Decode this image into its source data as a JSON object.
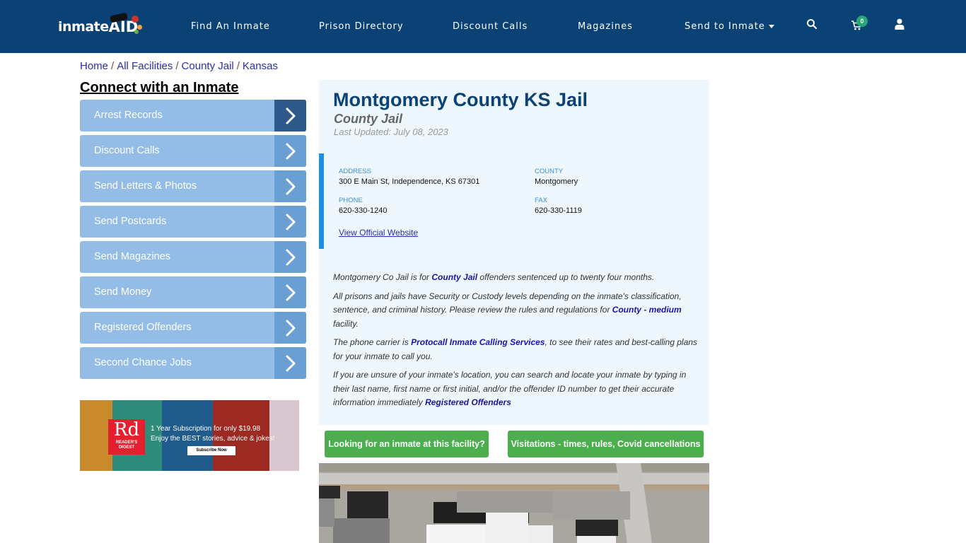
{
  "header": {
    "logo_text": "inmate",
    "logo_aid": "AID",
    "nav": [
      {
        "label": "Find An Inmate"
      },
      {
        "label": "Prison Directory"
      },
      {
        "label": "Discount Calls"
      },
      {
        "label": "Magazines"
      },
      {
        "label": "Send to Inmate",
        "has_dropdown": true
      }
    ],
    "icons": [
      "search-icon",
      "cart-icon",
      "user-icon"
    ],
    "cart_count": "0",
    "colors": {
      "bar": "#0b4275",
      "badge": "#25a776"
    }
  },
  "breadcrumb": {
    "items": [
      "Home",
      "All Facilities",
      "County Jail",
      "Kansas"
    ],
    "separator": "/"
  },
  "sidebar": {
    "title": "Connect with an Inmate",
    "items": [
      {
        "label": "Arrest Records"
      },
      {
        "label": "Discount Calls"
      },
      {
        "label": "Send Letters & Photos"
      },
      {
        "label": "Send Postcards"
      },
      {
        "label": "Send Magazines"
      },
      {
        "label": "Send Money"
      },
      {
        "label": "Registered Offenders"
      },
      {
        "label": "Second Chance Jobs"
      }
    ],
    "ad": {
      "brand_big": "Rd",
      "brand_small_1": "READER'S",
      "brand_small_2": "DIGEST",
      "line1": "1 Year Subscription for only $19.98",
      "line2": "Enjoy the BEST stories, advice & jokes!",
      "button": "Subscribe Now"
    }
  },
  "facility": {
    "name": "Montgomery County KS Jail",
    "type": "County Jail",
    "last_updated": "Last Updated: July 08, 2023",
    "address_label": "ADDRESS",
    "address": "300 E Main St, Independence, KS 67301",
    "county_label": "COUNTY",
    "county": "Montgomery",
    "phone_label": "PHONE",
    "phone": "620-330-1240",
    "fax_label": "FAX",
    "fax": "620-330-1119",
    "website_link": "View Official Website"
  },
  "description": {
    "p1_pre": "Montgomery Co Jail is for ",
    "p1_link": "County Jail",
    "p1_post": " offenders sentenced up to twenty four months.",
    "p2_pre": "All prisons and jails have Security or Custody levels depending on the inmate's classification, sentence, and criminal history. Please review the rules and regulations for ",
    "p2_link": "County - medium",
    "p2_post": " facility.",
    "p3_pre": "The phone carrier is ",
    "p3_link": "Protocall Inmate Calling Services",
    "p3_post": ", to see their rates and best-calling plans for your inmate to call you.",
    "p4_pre": "If you are unsure of your inmate's location, you can search and locate your inmate by typing in their last name, first name or first initial, and/or the offender ID number to get their accurate information immediately ",
    "p4_link": "Registered Offenders"
  },
  "actions": {
    "find_inmate": "Looking for an inmate at this facility?",
    "visitations": "Visitations - times, rules, Covid cancellations"
  }
}
